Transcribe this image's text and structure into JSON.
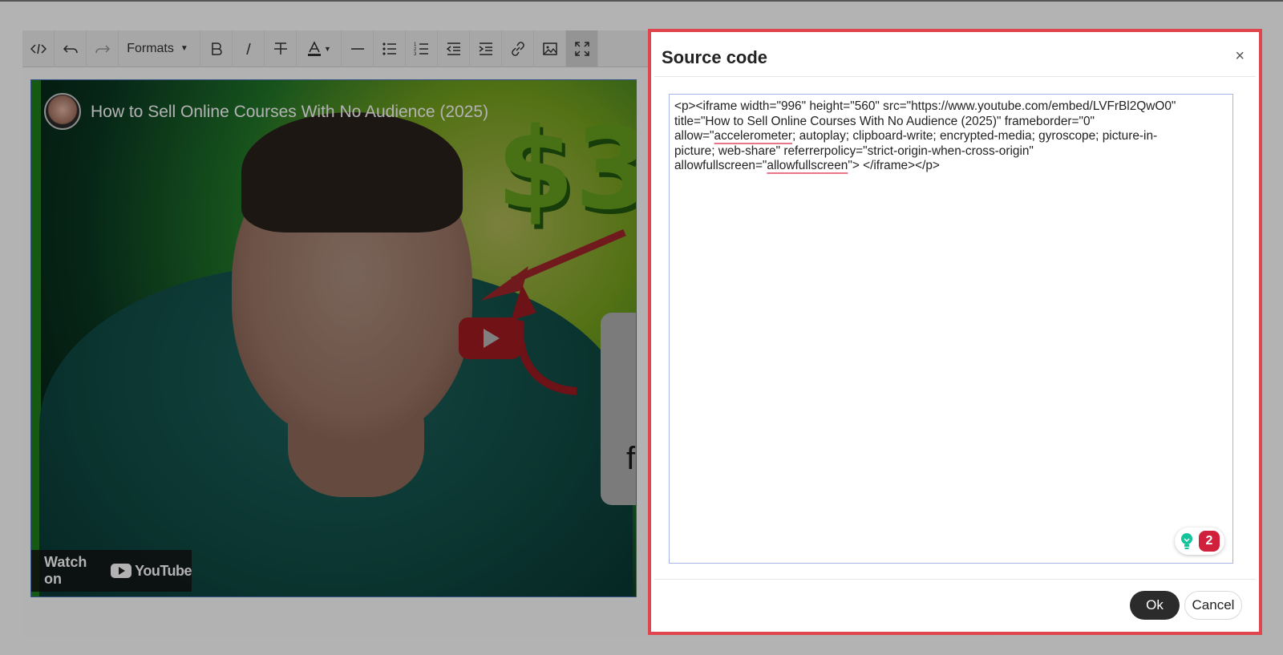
{
  "toolbar": {
    "formats_label": "Formats",
    "buttons": [
      "source-code",
      "undo",
      "redo",
      "formats",
      "bold",
      "italic",
      "strikethrough",
      "text-color",
      "horizontal-rule",
      "bullet-list",
      "numbered-list",
      "outdent",
      "indent",
      "link",
      "image",
      "fullscreen"
    ]
  },
  "video": {
    "title": "How to Sell Online Courses With No Audience (2025)",
    "watch_on": "Watch on",
    "brand": "YouTube",
    "thumbnail_text": "$3",
    "card_letter": "f"
  },
  "modal": {
    "title": "Source code",
    "close": "×",
    "code_lines": [
      "<p><iframe width=\"996\" height=\"560\" src=\"https://www.youtube.com/embed/LVFrBl2QwO0\"",
      "title=\"How to Sell Online Courses With No Audience (2025)\" frameborder=\"0\"",
      "allow=\"",
      "accelerometer",
      "; autoplay; clipboard-write; encrypted-media; gyroscope; picture-in-",
      "picture; web-share\" referrerpolicy=\"strict-origin-when-cross-origin\"",
      "allowfullscreen=\"",
      "allowfullscreen",
      "\"> </iframe></p>"
    ],
    "grammarly_count": "2",
    "ok_label": "Ok",
    "cancel_label": "Cancel"
  },
  "colors": {
    "modal_border": "#e0444c",
    "ok_button": "#2b2b2b",
    "youtube_red": "#e0262d",
    "grammarly_badge": "#d0203c"
  }
}
